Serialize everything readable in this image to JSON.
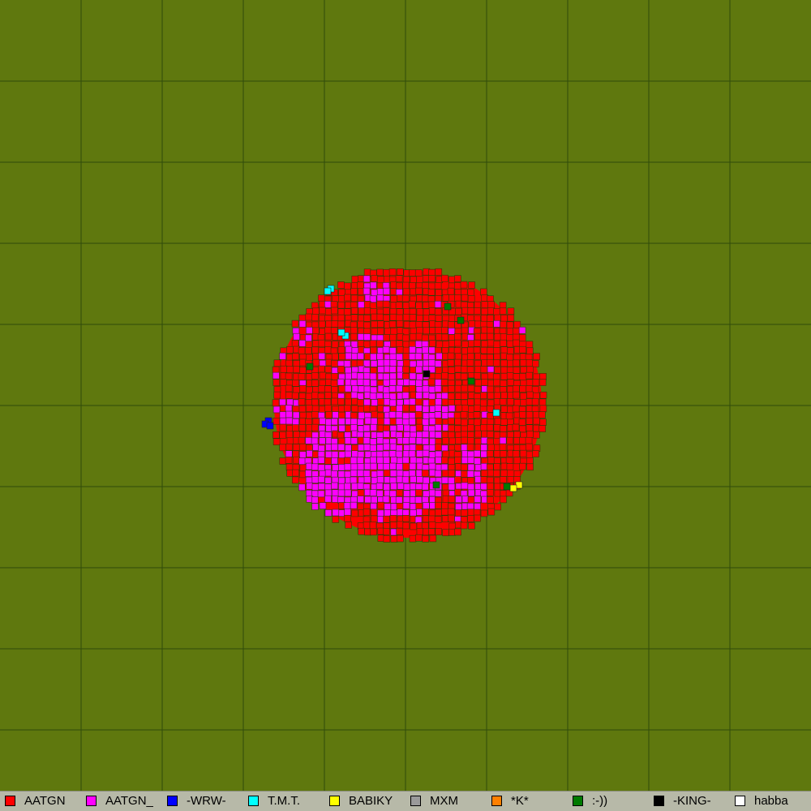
{
  "map": {
    "background_color": "#5f780e",
    "grid_color": "#2f4a0b",
    "cell_outline_color": "#2f3d08",
    "dominant_team_color": "#ff0000",
    "secondary_team_color": "#ff00ff",
    "territory_shape": "circular cluster",
    "grid_cells_per_side": 10
  },
  "legend": {
    "items": [
      {
        "label": "AATGN",
        "color": "#ff0000"
      },
      {
        "label": "AATGN_",
        "color": "#ff00ff"
      },
      {
        "label": "-WRW-",
        "color": "#0000ff"
      },
      {
        "label": "T.M.T.",
        "color": "#00ffff"
      },
      {
        "label": "BABIKY",
        "color": "#ffff00"
      },
      {
        "label": "MXM",
        "color": "#9a9a9a"
      },
      {
        "label": "*K*",
        "color": "#ff8000"
      },
      {
        "label": ":-))",
        "color": "#007a00"
      },
      {
        "label": "-KING-",
        "color": "#000000"
      },
      {
        "label": "habba",
        "color": "#ffffff"
      }
    ]
  }
}
